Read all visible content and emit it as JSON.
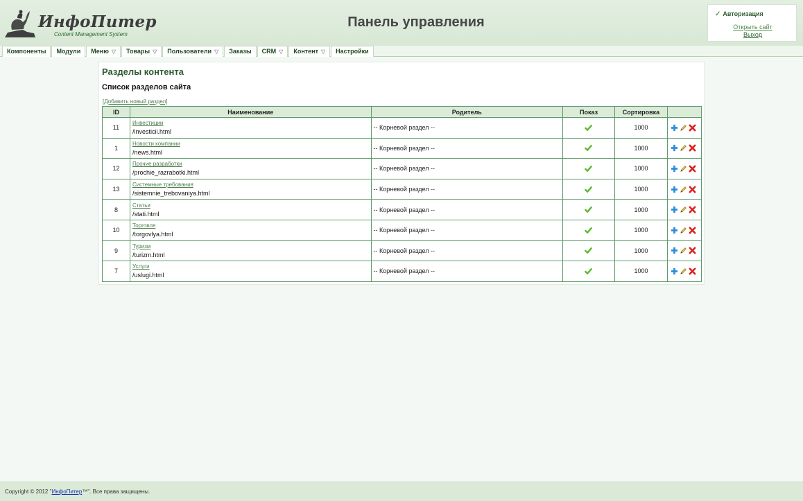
{
  "header": {
    "brand": "ИнфоПитер",
    "brand_sub": "Content Management System",
    "title": "Панель управления"
  },
  "auth": {
    "title": "Авторизация",
    "open_site": "Открыть сайт",
    "logout": "Выход"
  },
  "menu": {
    "items": [
      {
        "label": "Компоненты",
        "dropdown": false
      },
      {
        "label": "Модули",
        "dropdown": false
      },
      {
        "label": "Меню",
        "dropdown": true
      },
      {
        "label": "Товары",
        "dropdown": true
      },
      {
        "label": "Пользователи",
        "dropdown": true
      },
      {
        "label": "Заказы",
        "dropdown": false
      },
      {
        "label": "CRM",
        "dropdown": true
      },
      {
        "label": "Контент",
        "dropdown": true
      },
      {
        "label": "Настройки",
        "dropdown": false
      }
    ]
  },
  "main": {
    "heading": "Разделы контента",
    "subheading": "Список разделов сайта",
    "add_link": "[Добавить новый раздел]",
    "table": {
      "columns": [
        "ID",
        "Наименование",
        "Родитель",
        "Показ",
        "Сортировка",
        ""
      ],
      "rows": [
        {
          "id": "11",
          "title": "Инвестиции",
          "path": "/investicii.html",
          "parent": "-- Корневой раздел --",
          "shown": true,
          "sort": "1000"
        },
        {
          "id": "1",
          "title": "Новости компании",
          "path": "/news.html",
          "parent": "-- Корневой раздел --",
          "shown": true,
          "sort": "1000"
        },
        {
          "id": "12",
          "title": "Прочие разработки",
          "path": "/prochie_razrabotki.html",
          "parent": "-- Корневой раздел --",
          "shown": true,
          "sort": "1000"
        },
        {
          "id": "13",
          "title": "Системные требования",
          "path": "/sistemnie_trebovaniya.html",
          "parent": "-- Корневой раздел --",
          "shown": true,
          "sort": "1000"
        },
        {
          "id": "8",
          "title": "Статьи",
          "path": "/stati.html",
          "parent": "-- Корневой раздел --",
          "shown": true,
          "sort": "1000"
        },
        {
          "id": "10",
          "title": "Торговля",
          "path": "/torgovlya.html",
          "parent": "-- Корневой раздел --",
          "shown": true,
          "sort": "1000"
        },
        {
          "id": "9",
          "title": "Туризм",
          "path": "/turizm.html",
          "parent": "-- Корневой раздел --",
          "shown": true,
          "sort": "1000"
        },
        {
          "id": "7",
          "title": "Услуги",
          "path": "/uslugi.html",
          "parent": "-- Корневой раздел --",
          "shown": true,
          "sort": "1000"
        }
      ],
      "row_action_icons": [
        "plus-icon",
        "pencil-icon",
        "delete-icon"
      ]
    }
  },
  "footer": {
    "prefix": "Copyright © 2012 \"",
    "link": "ИнфоПитер",
    "suffix": "™\". Все права защищены."
  },
  "colors": {
    "accent_green": "#2f5a2f",
    "table_border": "#5a9a6a",
    "header_bg": "#dcebd8",
    "check_green": "#5cb82e",
    "delete_red": "#d9241b",
    "plus_blue": "#2b8fd6"
  }
}
